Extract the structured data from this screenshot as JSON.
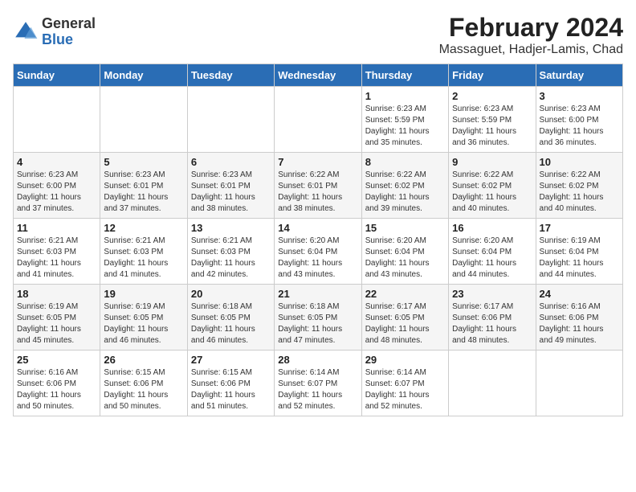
{
  "header": {
    "logo_general": "General",
    "logo_blue": "Blue",
    "title": "February 2024",
    "subtitle": "Massaguet, Hadjer-Lamis, Chad"
  },
  "days_of_week": [
    "Sunday",
    "Monday",
    "Tuesday",
    "Wednesday",
    "Thursday",
    "Friday",
    "Saturday"
  ],
  "weeks": [
    [
      {
        "day": "",
        "info": ""
      },
      {
        "day": "",
        "info": ""
      },
      {
        "day": "",
        "info": ""
      },
      {
        "day": "",
        "info": ""
      },
      {
        "day": "1",
        "info": "Sunrise: 6:23 AM\nSunset: 5:59 PM\nDaylight: 11 hours\nand 35 minutes."
      },
      {
        "day": "2",
        "info": "Sunrise: 6:23 AM\nSunset: 5:59 PM\nDaylight: 11 hours\nand 36 minutes."
      },
      {
        "day": "3",
        "info": "Sunrise: 6:23 AM\nSunset: 6:00 PM\nDaylight: 11 hours\nand 36 minutes."
      }
    ],
    [
      {
        "day": "4",
        "info": "Sunrise: 6:23 AM\nSunset: 6:00 PM\nDaylight: 11 hours\nand 37 minutes."
      },
      {
        "day": "5",
        "info": "Sunrise: 6:23 AM\nSunset: 6:01 PM\nDaylight: 11 hours\nand 37 minutes."
      },
      {
        "day": "6",
        "info": "Sunrise: 6:23 AM\nSunset: 6:01 PM\nDaylight: 11 hours\nand 38 minutes."
      },
      {
        "day": "7",
        "info": "Sunrise: 6:22 AM\nSunset: 6:01 PM\nDaylight: 11 hours\nand 38 minutes."
      },
      {
        "day": "8",
        "info": "Sunrise: 6:22 AM\nSunset: 6:02 PM\nDaylight: 11 hours\nand 39 minutes."
      },
      {
        "day": "9",
        "info": "Sunrise: 6:22 AM\nSunset: 6:02 PM\nDaylight: 11 hours\nand 40 minutes."
      },
      {
        "day": "10",
        "info": "Sunrise: 6:22 AM\nSunset: 6:02 PM\nDaylight: 11 hours\nand 40 minutes."
      }
    ],
    [
      {
        "day": "11",
        "info": "Sunrise: 6:21 AM\nSunset: 6:03 PM\nDaylight: 11 hours\nand 41 minutes."
      },
      {
        "day": "12",
        "info": "Sunrise: 6:21 AM\nSunset: 6:03 PM\nDaylight: 11 hours\nand 41 minutes."
      },
      {
        "day": "13",
        "info": "Sunrise: 6:21 AM\nSunset: 6:03 PM\nDaylight: 11 hours\nand 42 minutes."
      },
      {
        "day": "14",
        "info": "Sunrise: 6:20 AM\nSunset: 6:04 PM\nDaylight: 11 hours\nand 43 minutes."
      },
      {
        "day": "15",
        "info": "Sunrise: 6:20 AM\nSunset: 6:04 PM\nDaylight: 11 hours\nand 43 minutes."
      },
      {
        "day": "16",
        "info": "Sunrise: 6:20 AM\nSunset: 6:04 PM\nDaylight: 11 hours\nand 44 minutes."
      },
      {
        "day": "17",
        "info": "Sunrise: 6:19 AM\nSunset: 6:04 PM\nDaylight: 11 hours\nand 44 minutes."
      }
    ],
    [
      {
        "day": "18",
        "info": "Sunrise: 6:19 AM\nSunset: 6:05 PM\nDaylight: 11 hours\nand 45 minutes."
      },
      {
        "day": "19",
        "info": "Sunrise: 6:19 AM\nSunset: 6:05 PM\nDaylight: 11 hours\nand 46 minutes."
      },
      {
        "day": "20",
        "info": "Sunrise: 6:18 AM\nSunset: 6:05 PM\nDaylight: 11 hours\nand 46 minutes."
      },
      {
        "day": "21",
        "info": "Sunrise: 6:18 AM\nSunset: 6:05 PM\nDaylight: 11 hours\nand 47 minutes."
      },
      {
        "day": "22",
        "info": "Sunrise: 6:17 AM\nSunset: 6:05 PM\nDaylight: 11 hours\nand 48 minutes."
      },
      {
        "day": "23",
        "info": "Sunrise: 6:17 AM\nSunset: 6:06 PM\nDaylight: 11 hours\nand 48 minutes."
      },
      {
        "day": "24",
        "info": "Sunrise: 6:16 AM\nSunset: 6:06 PM\nDaylight: 11 hours\nand 49 minutes."
      }
    ],
    [
      {
        "day": "25",
        "info": "Sunrise: 6:16 AM\nSunset: 6:06 PM\nDaylight: 11 hours\nand 50 minutes."
      },
      {
        "day": "26",
        "info": "Sunrise: 6:15 AM\nSunset: 6:06 PM\nDaylight: 11 hours\nand 50 minutes."
      },
      {
        "day": "27",
        "info": "Sunrise: 6:15 AM\nSunset: 6:06 PM\nDaylight: 11 hours\nand 51 minutes."
      },
      {
        "day": "28",
        "info": "Sunrise: 6:14 AM\nSunset: 6:07 PM\nDaylight: 11 hours\nand 52 minutes."
      },
      {
        "day": "29",
        "info": "Sunrise: 6:14 AM\nSunset: 6:07 PM\nDaylight: 11 hours\nand 52 minutes."
      },
      {
        "day": "",
        "info": ""
      },
      {
        "day": "",
        "info": ""
      }
    ]
  ]
}
